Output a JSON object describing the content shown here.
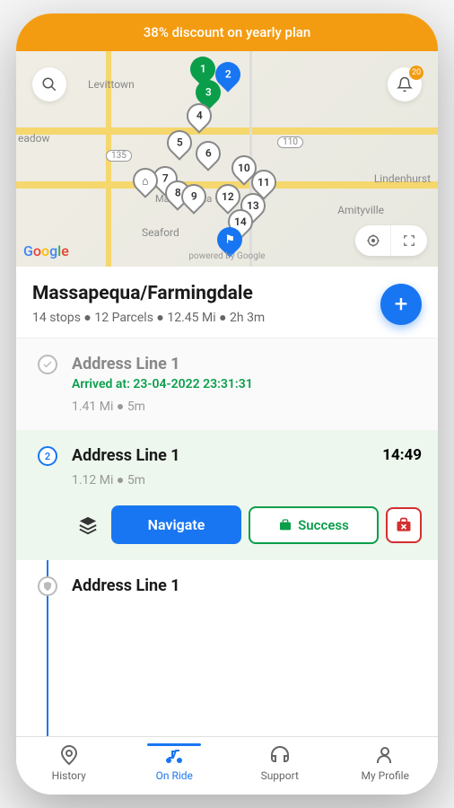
{
  "banner": {
    "text": "38% discount on yearly plan"
  },
  "map": {
    "notification_count": "20",
    "labels": {
      "levittown": "Levittown",
      "eadow": "eadow",
      "seaford": "Seaford",
      "lindenhurst": "Lindenhurst",
      "amityville": "Amityville",
      "massapequa": "Massapequa",
      "route135": "135",
      "route110": "110"
    },
    "pins": [
      "1",
      "2",
      "3",
      "4",
      "5",
      "6",
      "7",
      "8",
      "9",
      "10",
      "11",
      "12",
      "13",
      "14"
    ],
    "powered_by": "powered by Google"
  },
  "route": {
    "title": "Massapequa/Farmingdale",
    "stops": "14 stops",
    "parcels": "12 Parcels",
    "distance": "12.45 Mi",
    "duration": "2h 3m"
  },
  "stops": [
    {
      "title": "Address Line 1",
      "arrived_label": "Arrived at: 23-04-2022 23:31:31",
      "distance": "1.41 Mi",
      "duration": "5m"
    },
    {
      "number": "2",
      "title": "Address Line 1",
      "time": "14:49",
      "distance": "1.12 Mi",
      "duration": "5m",
      "navigate_label": "Navigate",
      "success_label": "Success"
    },
    {
      "title": "Address Line 1"
    }
  ],
  "nav": {
    "history": "History",
    "on_ride": "On Ride",
    "support": "Support",
    "profile": "My Profile"
  }
}
